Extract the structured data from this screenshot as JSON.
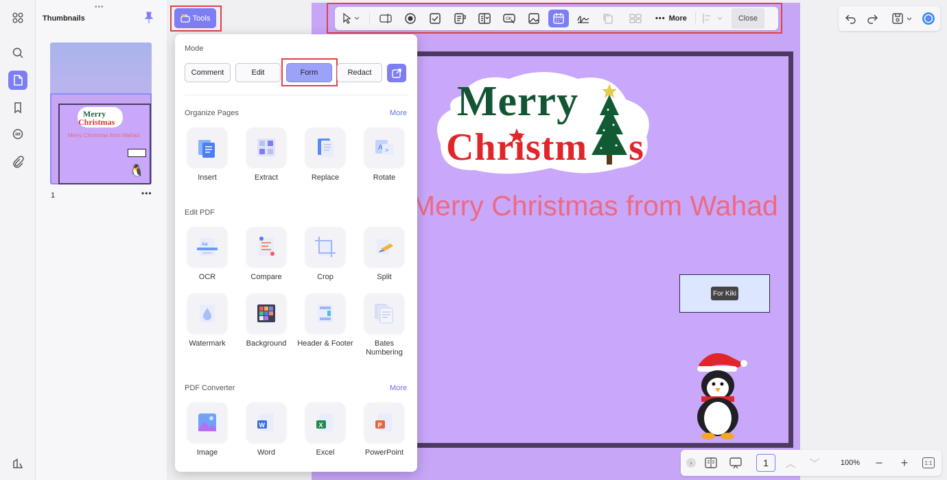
{
  "thumbnails": {
    "title": "Thumbnails",
    "page_number": "1",
    "more": "•••"
  },
  "thumb_preview": {
    "merry": "Merry",
    "christmas": "Christmas",
    "line": "Merry Christmas from Wahad"
  },
  "tools_button": {
    "label": "Tools"
  },
  "toolbar": {
    "more_label": "More",
    "close_label": "Close",
    "icons": [
      "cursor-icon",
      "text-field-icon",
      "radio-icon",
      "checkbox-icon",
      "list-box-icon",
      "dropdown-icon",
      "button-icon",
      "image-field-icon",
      "date-field-icon",
      "signature-icon",
      "copy-icon",
      "grid-icon",
      "align-icon"
    ]
  },
  "popup": {
    "mode_title": "Mode",
    "modes": [
      "Comment",
      "Edit",
      "Form",
      "Redact"
    ],
    "active_mode": "Form",
    "organize_title": "Organize Pages",
    "organize_more": "More",
    "organize": [
      "Insert",
      "Extract",
      "Replace",
      "Rotate"
    ],
    "edit_title": "Edit PDF",
    "edit": [
      "OCR",
      "Compare",
      "Crop",
      "Split",
      "Watermark",
      "Background",
      "Header & Footer",
      "Bates Numbering"
    ],
    "converter_title": "PDF Converter",
    "converter_more": "More",
    "converter": [
      "Image",
      "Word",
      "Excel",
      "PowerPoint"
    ]
  },
  "document": {
    "merry": "Merry",
    "christm": "Christm",
    "s": "s",
    "subline": "Merry Christmas from Wahad",
    "field_tooltip": "For Kiki"
  },
  "bottom_bar": {
    "page": "1",
    "zoom": "100%",
    "fit": "1:1"
  },
  "colors": {
    "accent": "#7d7ef3",
    "highlight": "#e04048",
    "page": "#c9a8fb",
    "frame": "#4c3a60"
  }
}
